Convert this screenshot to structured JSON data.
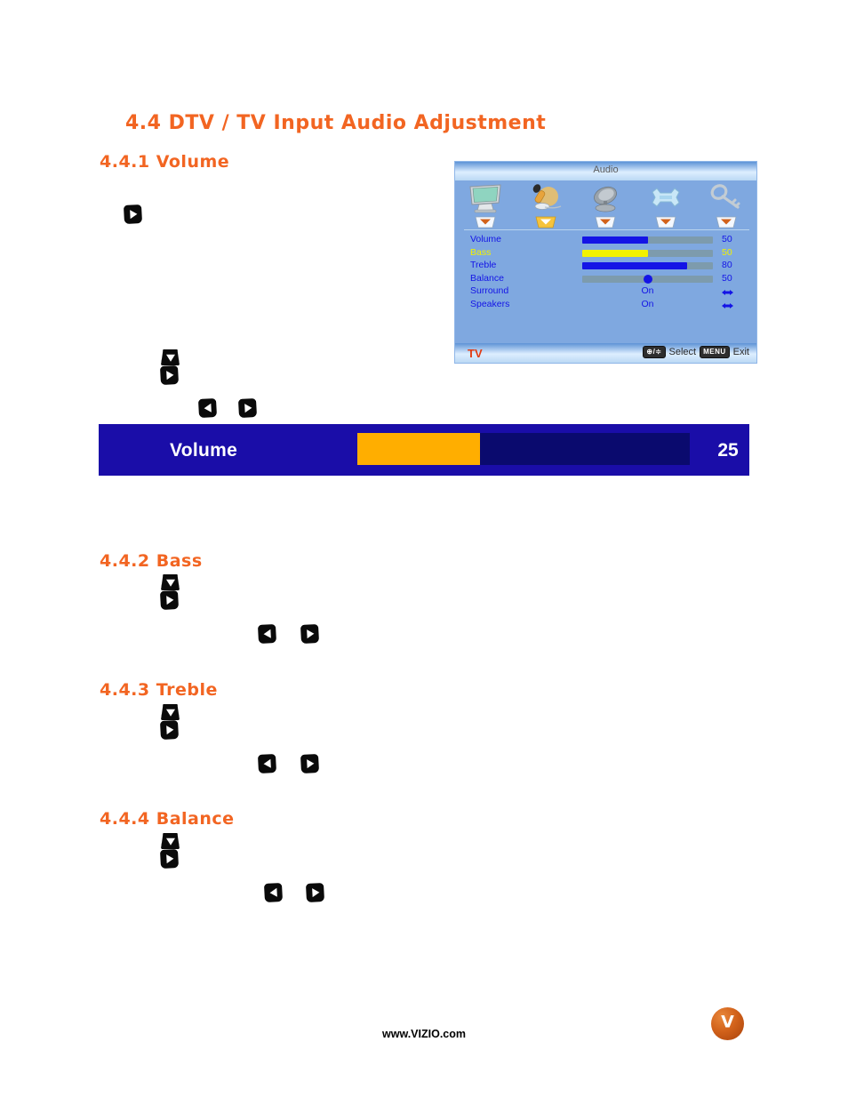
{
  "document": {
    "section_title": "4.4 DTV / TV Input Audio Adjustment",
    "subsections": [
      {
        "id": "volume",
        "title": "4.4.1 Volume"
      },
      {
        "id": "bass",
        "title": "4.4.2 Bass"
      },
      {
        "id": "treble",
        "title": "4.4.3 Treble"
      },
      {
        "id": "balance",
        "title": "4.4.4 Balance"
      }
    ]
  },
  "osd": {
    "title": "Audio",
    "source_label": "TV",
    "icons": [
      {
        "name": "picture-monitor-icon",
        "selected": false
      },
      {
        "name": "audio-microphone-icon",
        "selected": true
      },
      {
        "name": "tuner-satellite-dish-icon",
        "selected": false
      },
      {
        "name": "setup-wrench-icon",
        "selected": false
      },
      {
        "name": "parental-key-icon",
        "selected": false
      }
    ],
    "rows": [
      {
        "label": "Volume",
        "type": "bar",
        "value": "50",
        "percent": 50,
        "selected": false
      },
      {
        "label": "Bass",
        "type": "bar",
        "value": "50",
        "percent": 50,
        "selected": true
      },
      {
        "label": "Treble",
        "type": "bar",
        "value": "80",
        "percent": 80,
        "selected": false
      },
      {
        "label": "Balance",
        "type": "slider",
        "value": "50",
        "percent": 50,
        "selected": false
      },
      {
        "label": "Surround",
        "type": "toggle",
        "value": "On",
        "selected": false
      },
      {
        "label": "Speakers",
        "type": "toggle",
        "value": "On",
        "selected": false
      }
    ],
    "hints": {
      "nav_key": "⊕/≑",
      "select_label": "Select",
      "menu_key": "MENU",
      "exit_label": "Exit"
    }
  },
  "volume_banner": {
    "label": "Volume",
    "value": "25",
    "percent": 37
  },
  "footer": {
    "url": "www.VIZIO.com",
    "logo_letter": "V"
  },
  "colors": {
    "heading_orange": "#F26522",
    "banner_blue": "#1A0DA8",
    "banner_track": "#0A0A6E",
    "banner_fill": "#FFAE00",
    "osd_background": "#7FA8E0",
    "osd_text_blue": "#1414E6",
    "osd_selected_yellow": "#F2F200",
    "osd_track_gray": "#7D9BAD",
    "source_red": "#E23B12"
  }
}
